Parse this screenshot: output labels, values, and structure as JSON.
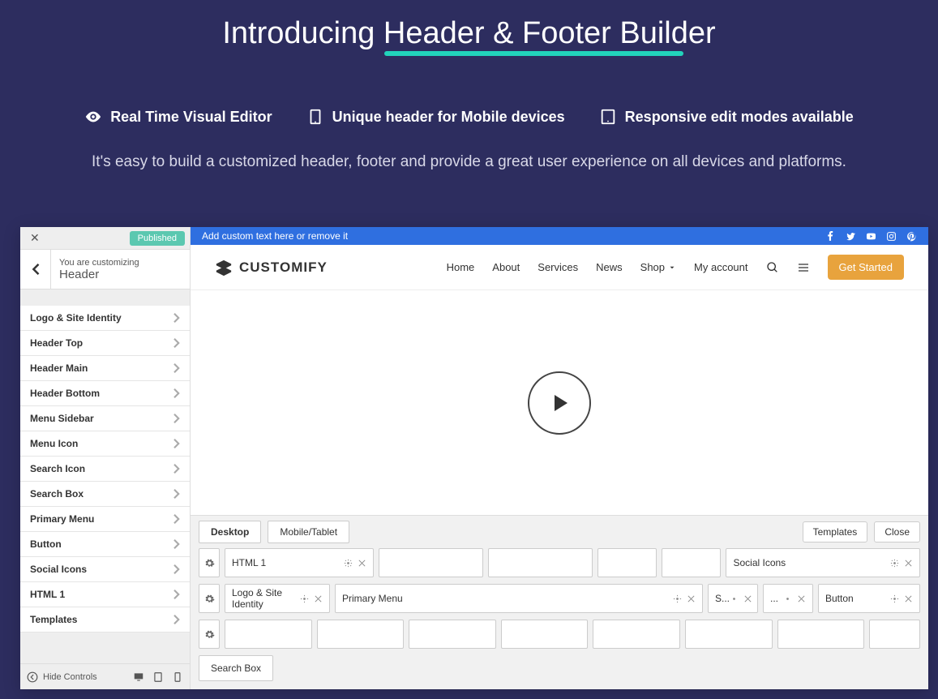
{
  "hero": {
    "title_prefix": "Introducing ",
    "title_underlined": "Header & Footer Builder",
    "features": [
      {
        "icon": "eye",
        "label": "Real Time Visual Editor"
      },
      {
        "icon": "mobile",
        "label": "Unique header for Mobile devices"
      },
      {
        "icon": "tablet",
        "label": "Responsive edit modes available"
      }
    ],
    "subtext": "It's easy to build a customized header, footer and provide a great user experience on all devices and platforms."
  },
  "customizer": {
    "published_badge": "Published",
    "pretitle": "You are customizing",
    "title": "Header",
    "items": [
      "Logo & Site Identity",
      "Header Top",
      "Header Main",
      "Header Bottom",
      "Menu Sidebar",
      "Menu Icon",
      "Search Icon",
      "Search Box",
      "Primary Menu",
      "Button",
      "Social Icons",
      "HTML 1",
      "Templates"
    ],
    "hide_controls": "Hide Controls"
  },
  "preview": {
    "topbar_text": "Add custom text here or remove it",
    "brand": "CUSTOMIFY",
    "nav": [
      "Home",
      "About",
      "Services",
      "News",
      "Shop",
      "My account"
    ],
    "cta": "Get Started"
  },
  "builder": {
    "tabs": {
      "desktop": "Desktop",
      "mobile": "Mobile/Tablet"
    },
    "buttons": {
      "templates": "Templates",
      "close": "Close"
    },
    "row1": {
      "col1": "HTML 1",
      "col7": "Social Icons"
    },
    "row2": {
      "col1": "Logo & Site Identity",
      "col2": "Primary Menu",
      "col3": "S...",
      "col4": "...",
      "col5": "Button"
    },
    "search_box": "Search Box"
  }
}
